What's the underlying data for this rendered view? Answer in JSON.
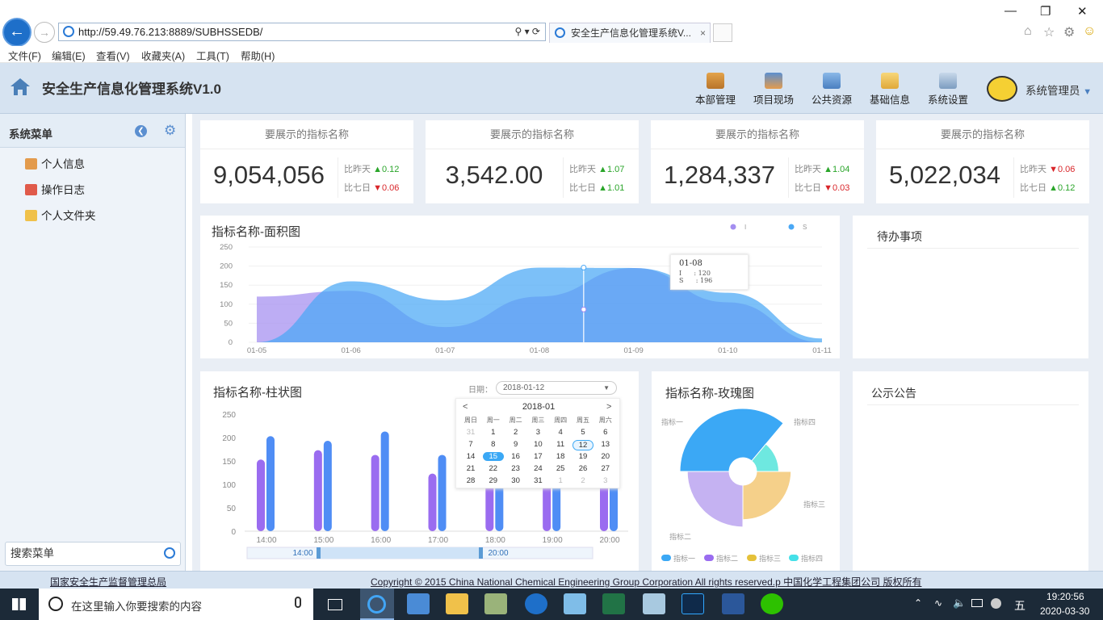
{
  "browser": {
    "url": "http://59.49.76.213:8889/SUBHSSEDB/",
    "tab_title": "安全生产信息化管理系统V...",
    "tab_close": "×",
    "menu": [
      "文件(F)",
      "编辑(E)",
      "查看(V)",
      "收藏夹(A)",
      "工具(T)",
      "帮助(H)"
    ]
  },
  "app": {
    "title": "安全生产信息化管理系统V1.0",
    "nav": [
      "本部管理",
      "项目现场",
      "公共资源",
      "基础信息",
      "系统设置"
    ],
    "user": "系统管理员"
  },
  "sidebar": {
    "title": "系统菜单",
    "items": [
      "个人信息",
      "操作日志",
      "个人文件夹"
    ],
    "search_placeholder": "搜索菜单"
  },
  "kpis": [
    {
      "name": "要展示的指标名称",
      "value": "9,054,056",
      "d1_label": "比昨天",
      "d1": "0.12",
      "d1_dir": "up",
      "d7_label": "比七日",
      "d7": "0.06",
      "d7_dir": "down"
    },
    {
      "name": "要展示的指标名称",
      "value": "3,542.00",
      "d1_label": "比昨天",
      "d1": "1.07",
      "d1_dir": "up",
      "d7_label": "比七日",
      "d7": "1.01",
      "d7_dir": "up"
    },
    {
      "name": "要展示的指标名称",
      "value": "1,284,337",
      "d1_label": "比昨天",
      "d1": "1.04",
      "d1_dir": "up",
      "d7_label": "比七日",
      "d7": "0.03",
      "d7_dir": "down"
    },
    {
      "name": "要展示的指标名称",
      "value": "5,022,034",
      "d1_label": "比昨天",
      "d1": "0.06",
      "d1_dir": "down",
      "d7_label": "比七日",
      "d7": "0.12",
      "d7_dir": "up"
    }
  ],
  "panels": {
    "area_title": "指标名称-面积图",
    "bar_title": "指标名称-柱状图",
    "rose_title": "指标名称-玫瑰图",
    "todo_title": "待办事项",
    "notice_title": "公示公告",
    "date_label": "日期：",
    "date_value": "2018-01-12"
  },
  "tooltip": {
    "title": "01-08",
    "l1": "I      : 120",
    "l2": "S      : 196"
  },
  "calendar": {
    "month": "2018-01",
    "weekdays": [
      "周日",
      "周一",
      "周二",
      "周三",
      "周四",
      "周五",
      "周六"
    ],
    "days": [
      "31",
      "1",
      "2",
      "3",
      "4",
      "5",
      "6",
      "7",
      "8",
      "9",
      "10",
      "11",
      "12",
      "13",
      "14",
      "15",
      "16",
      "17",
      "18",
      "19",
      "20",
      "21",
      "22",
      "23",
      "24",
      "25",
      "26",
      "27",
      "28",
      "29",
      "30",
      "31",
      "1",
      "2",
      "3"
    ],
    "selected": "12",
    "hover": "15"
  },
  "chart_data": [
    {
      "type": "area",
      "title": "指标名称-面积图",
      "x": [
        "01-05",
        "01-06",
        "01-07",
        "01-08",
        "01-09",
        "01-10",
        "01-11"
      ],
      "ylim": [
        0,
        250
      ],
      "yticks": [
        0,
        50,
        100,
        150,
        200,
        250
      ],
      "legend_position": "top-right",
      "series": [
        {
          "name": "I",
          "color": "#a48ef0",
          "values": [
            120,
            135,
            40,
            120,
            195,
            105,
            0
          ]
        },
        {
          "name": "S",
          "color": "#4aa8f5",
          "values": [
            0,
            160,
            110,
            196,
            195,
            130,
            10
          ]
        }
      ]
    },
    {
      "type": "bar",
      "title": "指标名称-柱状图",
      "categories": [
        "14:00",
        "15:00",
        "16:00",
        "17:00",
        "18:00",
        "19:00",
        "20:00"
      ],
      "ylim": [
        0,
        250
      ],
      "yticks": [
        0,
        50,
        100,
        150,
        200,
        250
      ],
      "slider_labels": [
        "14:00",
        "20:00"
      ],
      "series": [
        {
          "color": "#9a6cf0",
          "values": [
            153,
            173,
            163,
            123,
            140,
            145,
            135
          ]
        },
        {
          "color": "#4f8df5",
          "values": [
            203,
            193,
            213,
            163,
            175,
            180,
            165
          ]
        }
      ]
    },
    {
      "type": "pie",
      "title": "指标名称-玫瑰图",
      "rose": true,
      "categories": [
        "指标一",
        "指标四",
        "指标三",
        "指标二"
      ],
      "values": [
        100,
        45,
        70,
        85
      ],
      "colors": [
        "#3ba8f5",
        "#6ee8e0",
        "#f5d08a",
        "#c5b2f2"
      ],
      "legend": [
        "指标一",
        "指标二",
        "指标三",
        "指标四"
      ],
      "legend_colors": [
        "#3ba8f5",
        "#9a6cf0",
        "#e5c13a",
        "#45e0e8"
      ]
    }
  ],
  "footer": {
    "left": "国家安全生产监督管理总局",
    "right": "Copyright © 2015 China National Chemical Engineering Group Corporation All rights reserved.p 中国化学工程集团公司 版权所有"
  },
  "taskbar": {
    "search_placeholder": "在这里输入你要搜索的内容",
    "time": "19:20:56",
    "date": "2020-03-30",
    "ime": "五"
  }
}
